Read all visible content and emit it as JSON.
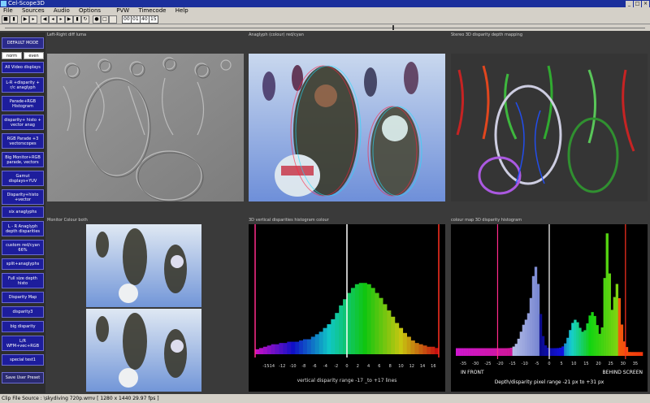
{
  "window": {
    "title": "Cel-Scope3D"
  },
  "menu": [
    "File",
    "Sources",
    "Audio",
    "Options",
    "PVW",
    "Timecode",
    "Help"
  ],
  "toolbar": {
    "timecode": [
      "00",
      "01",
      "40",
      "15"
    ]
  },
  "sidebar": {
    "top_label": "DEFAULT MODE",
    "norm_label": "norm",
    "even_label": "even",
    "items": [
      "All Video displays",
      "L-R +disparity +\nr/c anaglyph",
      "Parade+RGB\nHistogram",
      "disparity+ histo +\nvector anag",
      "RGB Parade +3\nvectorscopes",
      "Big Monitor+RGB\nparade, vectors",
      "Gamut\ndisplays+YUV",
      "Disparity+histo\n+vector",
      "six anaglyphs",
      "L - R Anaglyph\ndepth disparities",
      "custom red/cyan\n66%",
      "split+anaglyphs",
      "Full size depth\nhisto",
      "Disparity Map",
      "disparity3",
      "big disparity",
      "L/R\nWFM+vec+RGB",
      "special test1"
    ],
    "save_label": "Save User Preset"
  },
  "panels": {
    "p1": "Left-Right diff luma",
    "p2": "Anaglyph (colour) red/cyan",
    "p3": "Stereo 3D disparity depth mapping",
    "p4": "Monitor Colour both",
    "p5": "3D vertical disparities histogram colour",
    "p6": "colour map 3D disparity histogram"
  },
  "chart_data": [
    {
      "type": "bar",
      "title": "3D vertical disparities histogram colour",
      "xlabel": "vertical disparity range  -17 _to +17 lines",
      "x_ticks": [
        -15,
        -14,
        -12,
        -10,
        -8,
        -6,
        -4,
        -2,
        0,
        2,
        4,
        6,
        8,
        10,
        12,
        14,
        16
      ],
      "xlim": [
        -17,
        17
      ],
      "ylim": [
        0,
        100
      ],
      "values": [
        4,
        5,
        6,
        7,
        8,
        8,
        9,
        9,
        10,
        10,
        10,
        11,
        12,
        12,
        14,
        16,
        18,
        21,
        24,
        28,
        33,
        39,
        44,
        49,
        53,
        56,
        57,
        57,
        56,
        53,
        49,
        45,
        40,
        35,
        30,
        25,
        21,
        17,
        14,
        11,
        9,
        8,
        7,
        6,
        6,
        5
      ],
      "markers": [
        -17,
        0,
        17
      ]
    },
    {
      "type": "bar",
      "title": "colour map 3D disparity histogram",
      "xlabel": "Depth/disparity pixel range  -21  px to +31 px",
      "annotations": [
        "IN FRONT",
        "BEHIND SCREEN"
      ],
      "x_ticks": [
        -35,
        -30,
        -25,
        -20,
        -15,
        -10,
        -5,
        0,
        5,
        10,
        15,
        20,
        25,
        30,
        35
      ],
      "xlim": [
        -38,
        38
      ],
      "ylim": [
        0,
        100
      ],
      "markers": [
        -21,
        0,
        31
      ]
    }
  ],
  "status": {
    "text": "Clip File Source :  \\skydiving 720p.wmv       [ 1280 x 1440 29.97 fps ]"
  }
}
